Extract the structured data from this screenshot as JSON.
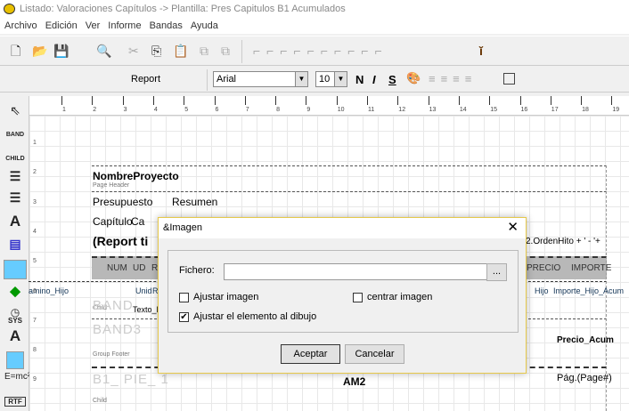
{
  "window": {
    "title": "Listado: Valoraciones Capítulos -> Plantilla: Pres Capitulos B1 Acumulados"
  },
  "menu": [
    "Archivo",
    "Edición",
    "Ver",
    "Informe",
    "Bandas",
    "Ayuda"
  ],
  "toolbar2": {
    "report_label": "Report",
    "font": "Arial",
    "size": "10",
    "bold": "N",
    "italic": "I",
    "strike": "S"
  },
  "ruler": {
    "ticks": [
      "1",
      "2",
      "3",
      "4",
      "5",
      "6",
      "7",
      "8",
      "9",
      "10",
      "11",
      "12",
      "13",
      "14",
      "15",
      "16",
      "17",
      "18",
      "19"
    ]
  },
  "rows": [
    "1",
    "2",
    "3",
    "4",
    "5",
    "6",
    "7",
    "8",
    "9"
  ],
  "palette": {
    "band": "BAND",
    "child": "CHILD",
    "sys": "SYS",
    "rtf": "RTF"
  },
  "report": {
    "nombre": "NombreProyecto",
    "page_header": "Page Header",
    "presupuesto": "Presupuesto",
    "resumen": "Resumen",
    "capitulo": "Capítulo",
    "ca": "Ca",
    "title": "(Report ti",
    "orden": "2.OrdenHito + ' - '+",
    "num": "NUM",
    "ud": "UD",
    "r": "R",
    "precio": "PRECIO",
    "importe": "IMPORTE",
    "camino": "amino_Hijo",
    "unid": "Unid",
    "r2": "R",
    "hijo": "Hijo",
    "importe_hijo": "Importe_Hijo_Acum",
    "child1": "Child",
    "band_ghost": "BAND",
    "texto": "Texto_P",
    "band3": "BAND3",
    "group_footer": "Group Footer",
    "precio_acum": "Precio_Acum",
    "pie": "B1_ PIE_ 1",
    "am2": "AM2",
    "pag": "Pág.(Page#)",
    "child2": "Child"
  },
  "dialog": {
    "title": "&Imagen",
    "fichero_label": "Fichero:",
    "fichero_value": "",
    "browse": "...",
    "ajustar_imagen": {
      "label": "Ajustar imagen",
      "checked": false
    },
    "centrar_imagen": {
      "label": "centrar imagen",
      "checked": false
    },
    "ajustar_elemento": {
      "label": "Ajustar el elemento al dibujo",
      "checked": true
    },
    "ok": "Aceptar",
    "cancel": "Cancelar"
  }
}
